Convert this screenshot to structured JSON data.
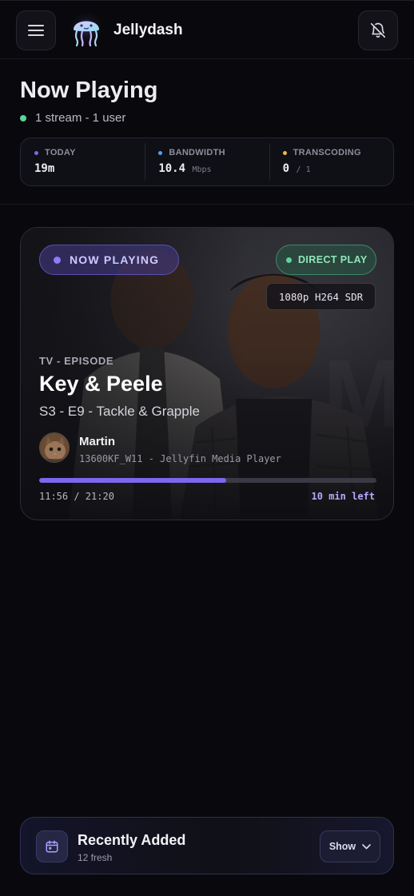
{
  "app": {
    "title": "Jellydash"
  },
  "header": {
    "menu_icon": "hamburger-menu-icon",
    "notification_icon": "bell-off-icon"
  },
  "page": {
    "title": "Now Playing",
    "status": "1 stream - 1 user",
    "status_color": "#5ed39b"
  },
  "stats": [
    {
      "label": "TODAY",
      "value": "19m",
      "unit": "",
      "dot_color": "#7b68ee"
    },
    {
      "label": "BANDWIDTH",
      "value": "10.4",
      "unit": "Mbps",
      "dot_color": "#5b9cf5"
    },
    {
      "label": "TRANSCODING",
      "value": "0",
      "unit": "/ 1",
      "dot_color": "#f0b84a"
    }
  ],
  "session": {
    "badge": "NOW PLAYING",
    "play_method": "DIRECT PLAY",
    "quality": "1080p H264 SDR",
    "media_type": "TV - EPISODE",
    "title": "Key & Peele",
    "episode": "S3 - E9 - Tackle & Grapple",
    "user": "Martin",
    "device": "13600KF_W11 - Jellyfin Media Player",
    "progress_fraction": 0.555,
    "time": "11:56 / 21:20",
    "remaining": "10 min left"
  },
  "recent": {
    "title": "Recently Added",
    "subtitle": "12 fresh",
    "button": "Show",
    "icon": "calendar-icon"
  },
  "colors": {
    "accent": "#7b68ee",
    "background": "#09090d",
    "direct_play": "#5ed39b"
  }
}
